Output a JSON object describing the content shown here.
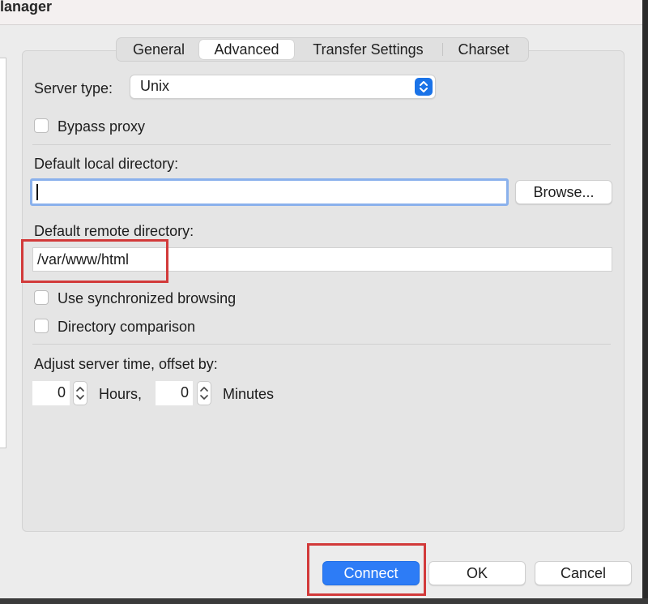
{
  "window": {
    "title": "lanager"
  },
  "tabs": [
    {
      "label": "General",
      "selected": false
    },
    {
      "label": "Advanced",
      "selected": true
    },
    {
      "label": "Transfer Settings",
      "selected": false
    },
    {
      "label": "Charset",
      "selected": false
    }
  ],
  "server_type": {
    "label": "Server type:",
    "value": "Unix"
  },
  "bypass_proxy": {
    "label": "Bypass proxy",
    "checked": false
  },
  "local_dir": {
    "label": "Default local directory:",
    "value": "",
    "browse_label": "Browse..."
  },
  "remote_dir": {
    "label": "Default remote directory:",
    "value": "/var/www/html"
  },
  "sync_browsing": {
    "label": "Use synchronized browsing",
    "checked": false
  },
  "dir_comparison": {
    "label": "Directory comparison",
    "checked": false
  },
  "time_offset": {
    "label": "Adjust server time, offset by:",
    "hours_value": "0",
    "hours_label": "Hours,",
    "minutes_value": "0",
    "minutes_label": "Minutes"
  },
  "footer": {
    "connect_label": "Connect",
    "ok_label": "OK",
    "cancel_label": "Cancel"
  },
  "colors": {
    "accent": "#2d7cf6",
    "highlight": "#d23a3a",
    "focus_ring": "#8ab1ec"
  }
}
